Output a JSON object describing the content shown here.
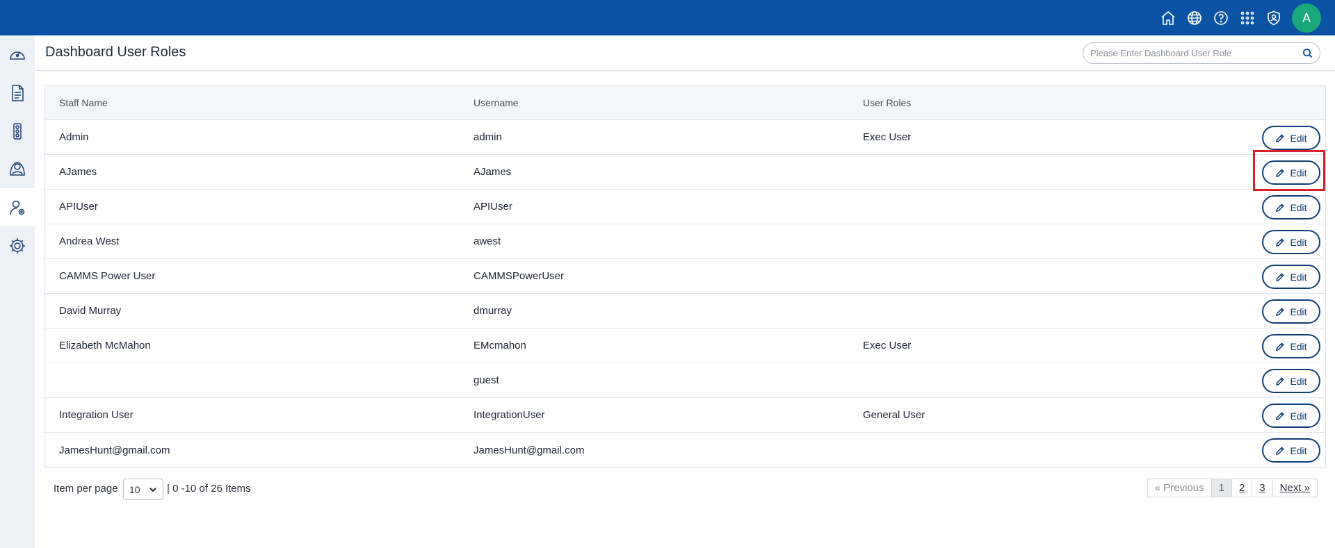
{
  "header": {
    "avatar_letter": "A",
    "icons": [
      "home-icon",
      "globe-icon",
      "help-icon",
      "apps-grid-icon",
      "shield-user-icon"
    ]
  },
  "sidebar": {
    "items": [
      {
        "icon": "dashboard-gauge-icon"
      },
      {
        "icon": "document-icon"
      },
      {
        "icon": "traffic-light-icon"
      },
      {
        "icon": "user-network-icon"
      },
      {
        "icon": "user-settings-icon",
        "active": true
      },
      {
        "icon": "gear-icon"
      }
    ]
  },
  "page": {
    "title": "Dashboard User Roles",
    "search_placeholder": "Please Enter Dashboard User Role"
  },
  "table": {
    "columns": [
      "Staff Name",
      "Username",
      "User Roles"
    ],
    "edit_label": "Edit",
    "rows": [
      {
        "staff": "Admin",
        "username": "admin",
        "roles": "Exec User"
      },
      {
        "staff": "AJames",
        "username": "AJames",
        "roles": ""
      },
      {
        "staff": "APIUser",
        "username": "APIUser",
        "roles": ""
      },
      {
        "staff": "Andrea West",
        "username": "awest",
        "roles": ""
      },
      {
        "staff": "CAMMS Power User",
        "username": "CAMMSPowerUser",
        "roles": ""
      },
      {
        "staff": "David Murray",
        "username": "dmurray",
        "roles": ""
      },
      {
        "staff": "Elizabeth McMahon",
        "username": "EMcmahon",
        "roles": "Exec User"
      },
      {
        "staff": "",
        "username": "guest",
        "roles": ""
      },
      {
        "staff": "Integration User",
        "username": "IntegrationUser",
        "roles": "General User"
      },
      {
        "staff": "JamesHunt@gmail.com",
        "username": "JamesHunt@gmail.com",
        "roles": ""
      }
    ]
  },
  "footer": {
    "items_per_page_label": "Item per page",
    "items_per_page_value": "10",
    "count_text": "| 0 -10 of 26 Items",
    "pager": {
      "previous": "«  Previous",
      "pages": [
        "1",
        "2",
        "3"
      ],
      "current": "1",
      "next": "Next  »"
    }
  },
  "colors": {
    "topbar": "#0a52a3",
    "avatar": "#1aa87b",
    "button_border": "#0f3d73",
    "highlight": "#d6202b"
  }
}
